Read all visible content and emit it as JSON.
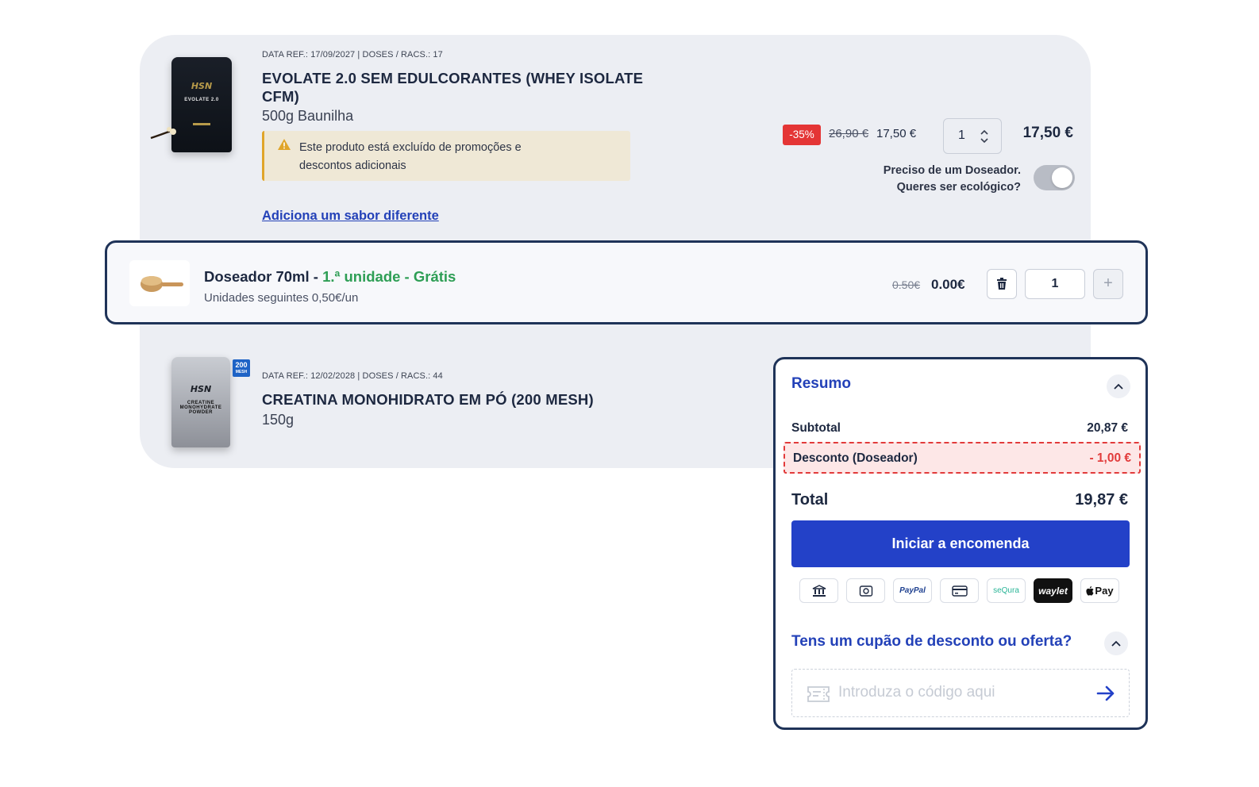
{
  "product1": {
    "meta": "DATA REF.: 17/09/2027 | DOSES / RACS.: 17",
    "title_line1": "EVOLATE 2.0 SEM EDULCORANTES (WHEY ISOLATE",
    "title_line2": "CFM)",
    "variant": "500g Baunilha",
    "bag_logo": "HSN",
    "bag_name": "EVOLATE 2.0",
    "warning_line1": "Este produto está excluído de promoções e",
    "warning_line2": "descontos adicionais",
    "add_flavor_link": "Adiciona um sabor diferente",
    "discount_badge": "-35%",
    "old_price": "26,90 €",
    "unit_price": "17,50 €",
    "quantity": "1",
    "line_total": "17,50 €",
    "doser_question_line1": "Preciso de um Doseador.",
    "doser_question_line2": "Queres ser  ecológico?",
    "doser_toggle_on": true
  },
  "doser": {
    "name": "Doseador 70ml - ",
    "promo": "1.ª unidade - Grátis",
    "subtitle": "Unidades seguintes 0,50€/un",
    "old_price": "0.50€",
    "price": "0.00€",
    "quantity": "1",
    "plus_label": "+"
  },
  "product2": {
    "meta": "DATA REF.: 12/02/2028 | DOSES / RACS.: 44",
    "title": "CREATINA MONOHIDRATO EM PÓ (200 MESH)",
    "variant": "150g",
    "bag_logo": "HSN",
    "bag_name": "CREATINE MONOHYDRATE POWDER",
    "mesh_badge_num": "200",
    "mesh_badge_label": "MESH"
  },
  "summary": {
    "title": "Resumo",
    "subtotal_label": "Subtotal",
    "subtotal_value": "20,87 €",
    "discount_label": "Desconto (Doseador)",
    "discount_value": "- 1,00 €",
    "total_label": "Total",
    "total_value": "19,87 €",
    "checkout_label": "Iniciar a encomenda",
    "payment_methods": {
      "paypal": "PayPal",
      "sequra": "seQura",
      "waylet": "waylet",
      "applepay": "Pay"
    },
    "coupon_title": "Tens um cupão de desconto ou oferta?",
    "coupon_placeholder": "Introduza o código aqui"
  },
  "colors": {
    "accent_blue": "#2341c8",
    "discount_red": "#e23b3b",
    "promo_green": "#2e9e55",
    "frame_navy": "#1f3358"
  }
}
